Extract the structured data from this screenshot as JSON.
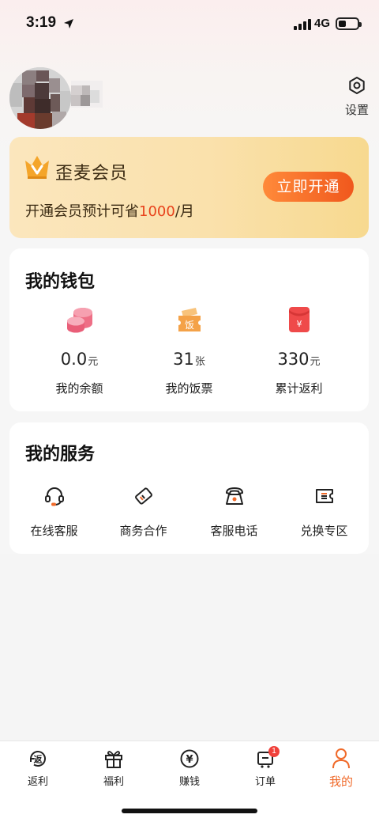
{
  "status_bar": {
    "time": "3:19",
    "network": "4G"
  },
  "header": {
    "settings_label": "设置"
  },
  "vip": {
    "title": "歪麦会员",
    "desc_prefix": "开通会员预计可省",
    "desc_amount": "1000",
    "desc_suffix": "/月",
    "button_label": "立即开通"
  },
  "wallet": {
    "title": "我的钱包",
    "items": [
      {
        "value": "0.0",
        "unit": "元",
        "label": "我的余额",
        "icon": "coins-icon"
      },
      {
        "value": "31",
        "unit": "张",
        "label": "我的饭票",
        "icon": "meal-ticket-icon"
      },
      {
        "value": "330",
        "unit": "元",
        "label": "累计返利",
        "icon": "red-envelope-icon"
      }
    ]
  },
  "services": {
    "title": "我的服务",
    "items": [
      {
        "label": "在线客服",
        "icon": "headset-icon"
      },
      {
        "label": "商务合作",
        "icon": "card-icon"
      },
      {
        "label": "客服电话",
        "icon": "telephone-icon"
      },
      {
        "label": "兑换专区",
        "icon": "ticket-icon"
      }
    ]
  },
  "tabbar": {
    "items": [
      {
        "label": "返利",
        "icon": "rebate-icon",
        "active": false
      },
      {
        "label": "福利",
        "icon": "gift-icon",
        "active": false
      },
      {
        "label": "赚钱",
        "icon": "yen-coin-icon",
        "active": false
      },
      {
        "label": "订单",
        "icon": "order-icon",
        "active": false,
        "badge": "1"
      },
      {
        "label": "我的",
        "icon": "user-icon",
        "active": true
      }
    ]
  },
  "colors": {
    "accent": "#f06a2a",
    "vip_price": "#e8421b",
    "badge": "#f0403a"
  }
}
